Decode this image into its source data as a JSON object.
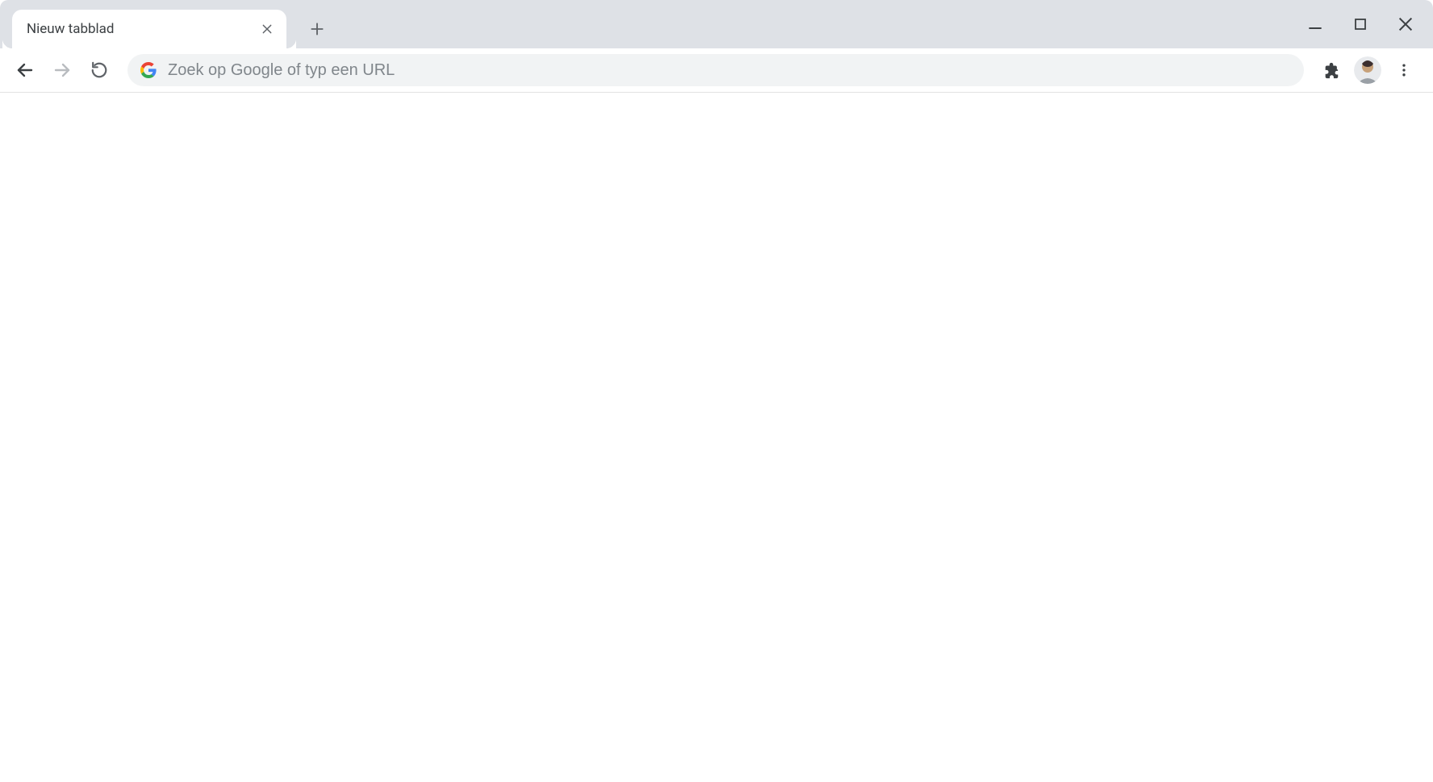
{
  "tab": {
    "title": "Nieuw tabblad"
  },
  "omnibox": {
    "placeholder": "Zoek op Google of typ een URL",
    "value": ""
  },
  "icons": {
    "close": "close-icon",
    "plus": "plus-icon",
    "minimize": "minimize-icon",
    "maximize": "maximize-icon",
    "windowClose": "close-window-icon",
    "back": "back-arrow-icon",
    "forward": "forward-arrow-icon",
    "reload": "reload-icon",
    "google": "google-g-icon",
    "extensions": "extensions-puzzle-icon",
    "avatar": "profile-avatar",
    "menu": "kebab-menu-icon"
  },
  "nav": {
    "backEnabled": true,
    "forwardEnabled": false
  }
}
